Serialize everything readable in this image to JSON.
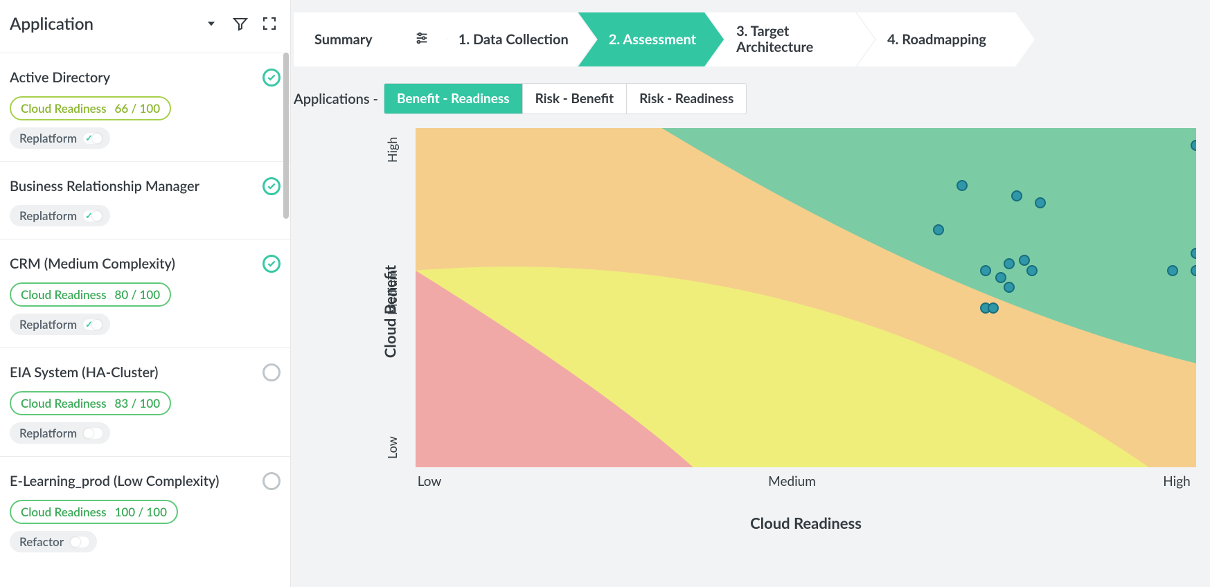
{
  "sidebar": {
    "title": "Application",
    "items": [
      {
        "name": "Active Directory",
        "checked": true,
        "readiness_label": "Cloud Readiness",
        "readiness_score": "66 / 100",
        "readiness_level": "mid",
        "strategy": "Replatform",
        "strategy_on": true
      },
      {
        "name": "Business Relationship Manager",
        "checked": true,
        "readiness_label": null,
        "readiness_score": null,
        "readiness_level": null,
        "strategy": "Replatform",
        "strategy_on": true
      },
      {
        "name": "CRM (Medium Complexity)",
        "checked": true,
        "readiness_label": "Cloud Readiness",
        "readiness_score": "80 / 100",
        "readiness_level": "high",
        "strategy": "Replatform",
        "strategy_on": true
      },
      {
        "name": "EIA System (HA-Cluster)",
        "checked": false,
        "readiness_label": "Cloud Readiness",
        "readiness_score": "83 / 100",
        "readiness_level": "high",
        "strategy": "Replatform",
        "strategy_on": false
      },
      {
        "name": "E-Learning_prod (Low Complexity)",
        "checked": false,
        "readiness_label": "Cloud Readiness",
        "readiness_score": "100 / 100",
        "readiness_level": "high",
        "strategy": "Refactor",
        "strategy_on": false
      }
    ]
  },
  "stepper": {
    "summary": "Summary",
    "steps": [
      "1. Data Collection",
      "2. Assessment",
      "3. Target Architecture",
      "4. Roadmapping"
    ],
    "active_index": 1
  },
  "chart_tabs": {
    "label": "Applications -",
    "tabs": [
      "Benefit - Readiness",
      "Risk - Benefit",
      "Risk - Readiness"
    ],
    "active_index": 0
  },
  "chart": {
    "x_title": "Cloud Readiness",
    "y_title": "Cloud Benefit",
    "x_ticks": [
      "Low",
      "Medium",
      "High"
    ],
    "y_ticks": [
      "Low",
      "Medium",
      "High"
    ]
  },
  "chart_data": {
    "type": "scatter",
    "title": "",
    "xlabel": "Cloud Readiness",
    "ylabel": "Cloud Benefit",
    "xlim": [
      0,
      100
    ],
    "ylim": [
      0,
      100
    ],
    "x_tick_labels": {
      "0": "Low",
      "50": "Medium",
      "100": "High"
    },
    "y_tick_labels": {
      "0": "Low",
      "50": "Medium",
      "100": "High"
    },
    "zones": [
      {
        "name": "red",
        "color": "#f0a9a7"
      },
      {
        "name": "yellow",
        "color": "#efee7b"
      },
      {
        "name": "orange",
        "color": "#f5ce8c"
      },
      {
        "name": "green",
        "color": "#7bcca5"
      }
    ],
    "series": [
      {
        "name": "Applications",
        "color": "#2f97a8",
        "points": [
          {
            "x": 100,
            "y": 95
          },
          {
            "x": 70,
            "y": 83
          },
          {
            "x": 77,
            "y": 80
          },
          {
            "x": 80,
            "y": 78
          },
          {
            "x": 67,
            "y": 70
          },
          {
            "x": 100,
            "y": 63
          },
          {
            "x": 78,
            "y": 61
          },
          {
            "x": 76,
            "y": 60
          },
          {
            "x": 97,
            "y": 58
          },
          {
            "x": 100,
            "y": 58
          },
          {
            "x": 79,
            "y": 58
          },
          {
            "x": 73,
            "y": 58
          },
          {
            "x": 75,
            "y": 56
          },
          {
            "x": 76,
            "y": 53
          },
          {
            "x": 73,
            "y": 47
          },
          {
            "x": 74,
            "y": 47
          }
        ]
      }
    ]
  }
}
